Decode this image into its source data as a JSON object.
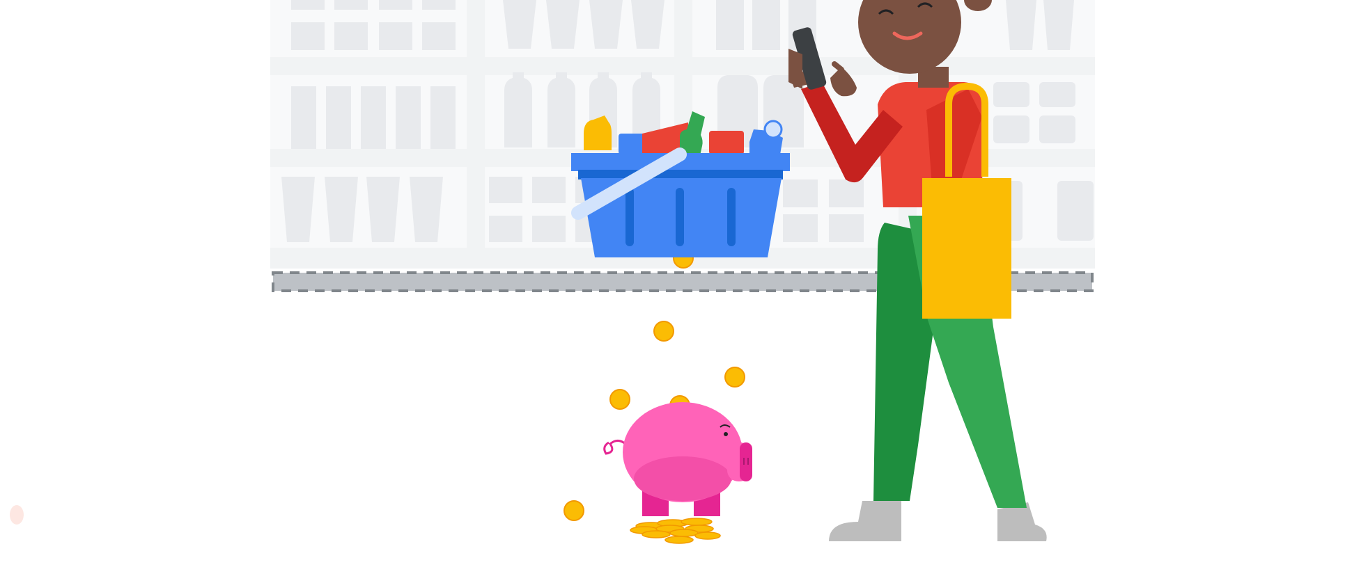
{
  "scene": {
    "colors": {
      "background": "#ffffff",
      "shelf": "#f1f3f4",
      "shelf_item": "#e8eaed",
      "price_rail": "#bdc1c6",
      "basket_blue": "#4285f4",
      "basket_dark": "#1967d2",
      "handle": "#d2e3fc",
      "coin": "#fbbc04",
      "coin_edge": "#f29900",
      "piggy": "#ff63b8",
      "piggy_dark": "#e52592",
      "skin": "#7b5141",
      "shirt": "#ea4335",
      "sleeve": "#c5221f",
      "pants_light": "#34a853",
      "pants_dark": "#1e8e3e",
      "bag": "#fbbc04",
      "shoe": "#bdbdbd"
    },
    "icons": [
      "store-shelves",
      "shopping-basket",
      "piggy-bank",
      "gold-coins",
      "shopper",
      "smartphone",
      "tote-bag"
    ]
  }
}
